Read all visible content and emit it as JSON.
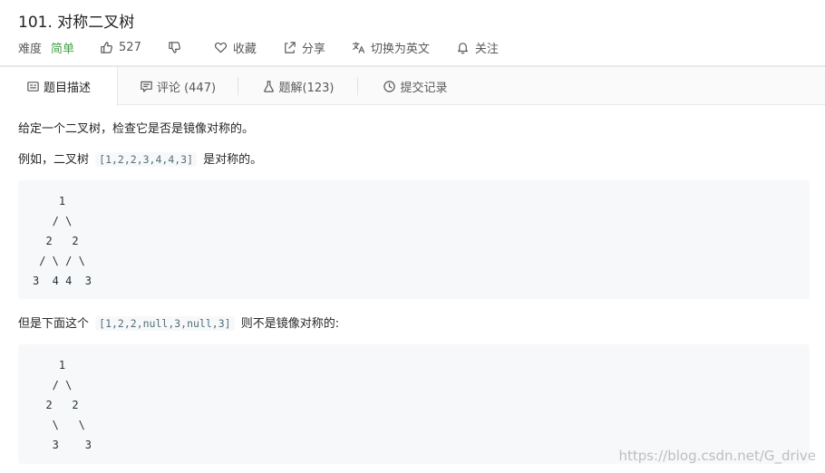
{
  "problem": {
    "title": "101. 对称二叉树",
    "difficulty_label": "难度",
    "difficulty": "简单",
    "likes": "527",
    "favorite_label": "收藏",
    "share_label": "分享",
    "translate_label": "切换为英文",
    "follow_label": "关注"
  },
  "tabs": [
    {
      "label": "题目描述"
    },
    {
      "label": "评论 (447)"
    },
    {
      "label": "题解(123)"
    },
    {
      "label": "提交记录"
    }
  ],
  "content": {
    "intro": "给定一个二叉树，检查它是否是镜像对称的。",
    "example1_prefix": "例如，二叉树",
    "example1_code": "[1,2,2,3,4,4,3]",
    "example1_suffix": "是对称的。",
    "tree1": "    1\n   / \\\n  2   2\n / \\ / \\\n3  4 4  3",
    "example2_prefix": "但是下面这个",
    "example2_code": "[1,2,2,null,3,null,3]",
    "example2_suffix": "则不是镜像对称的:",
    "tree2": "    1\n   / \\\n  2   2\n   \\   \\\n   3    3"
  },
  "watermark": "https://blog.csdn.net/G_drive",
  "colors": {
    "difficulty_easy": "#43a047",
    "code_background": "#f7f8fa",
    "inline_code_text": "#546e7a"
  }
}
